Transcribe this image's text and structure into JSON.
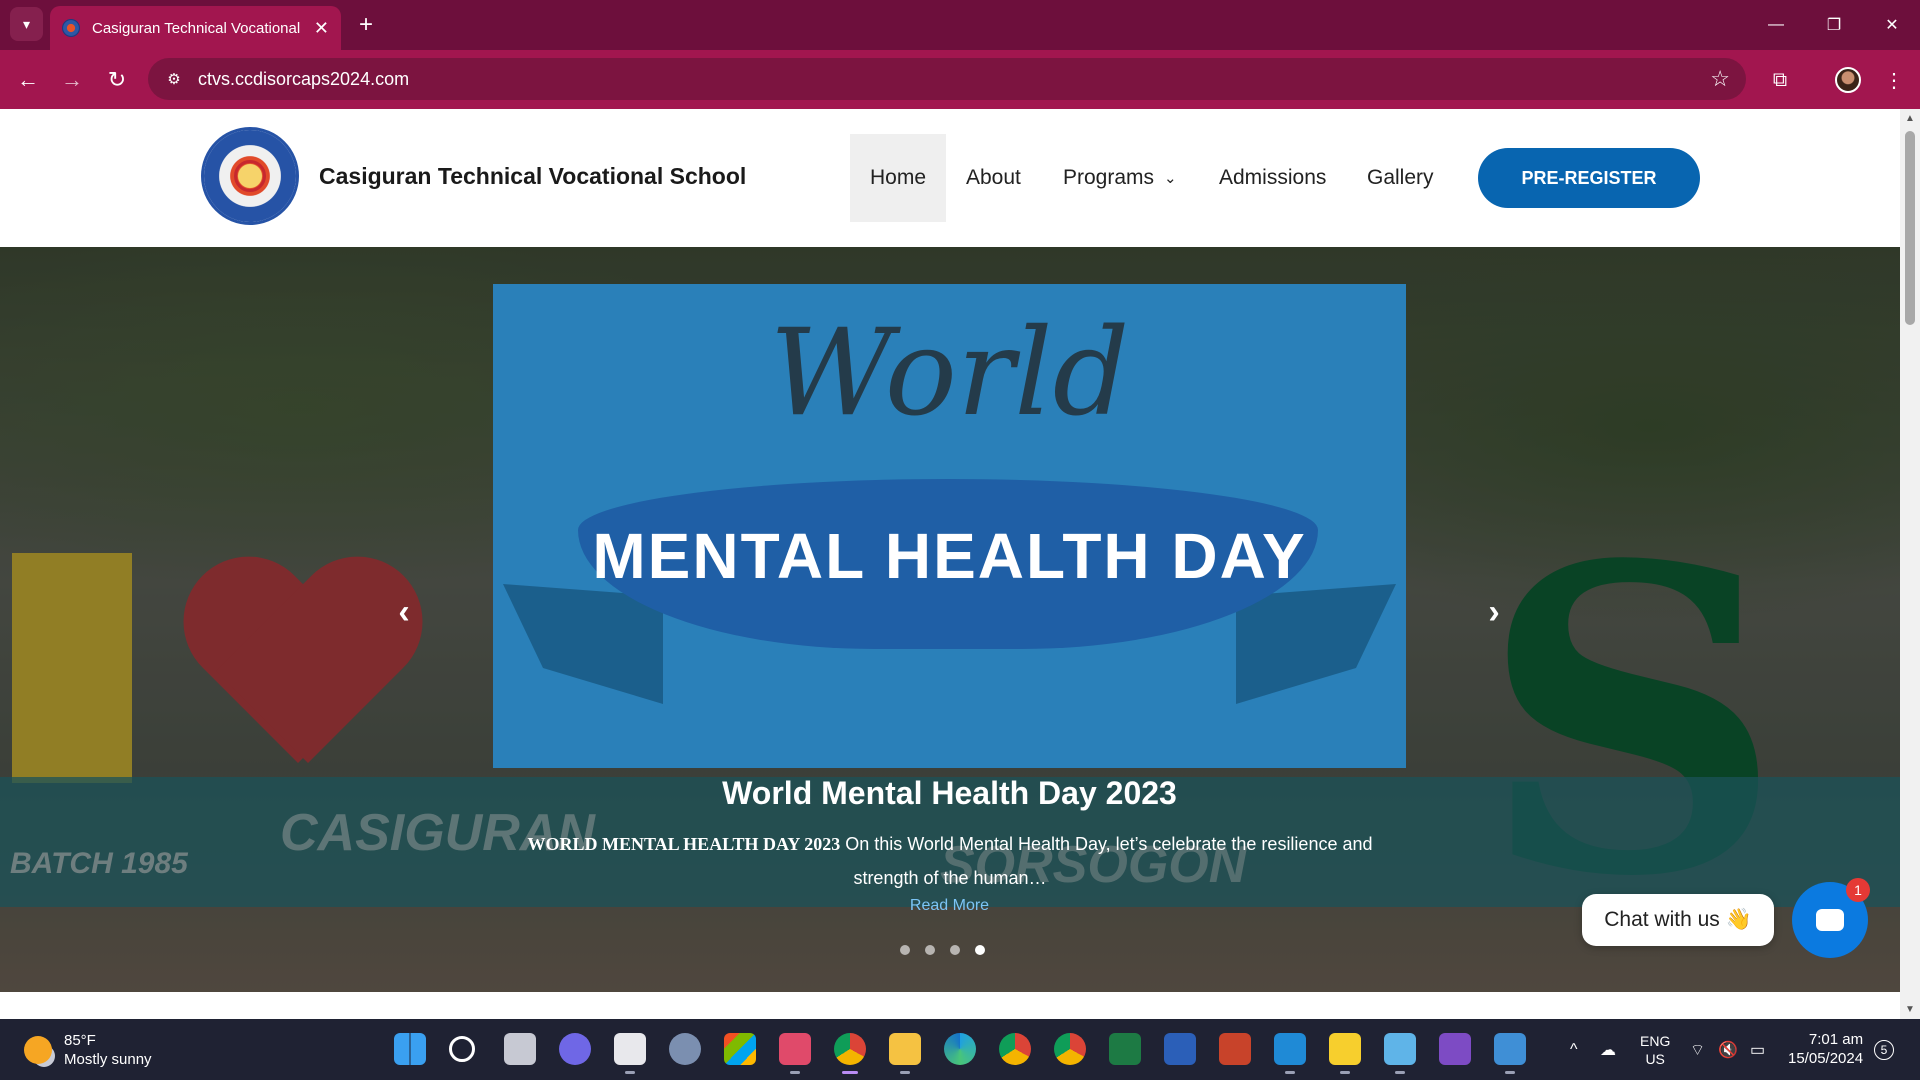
{
  "browser": {
    "tab_title": "Casiguran Technical Vocational",
    "url": "ctvs.ccdisorcaps2024.com",
    "icons": [
      "tab-search-icon",
      "close-icon",
      "new-tab-icon",
      "minimize-icon",
      "restore-icon",
      "window-close-icon",
      "back-icon",
      "forward-icon",
      "reload-icon",
      "site-info-icon",
      "star-icon",
      "extensions-icon",
      "profile-avatar",
      "menu-icon"
    ]
  },
  "site": {
    "name": "Casiguran Technical Vocational School",
    "nav": [
      "Home",
      "About",
      "Programs",
      "Admissions",
      "Gallery"
    ],
    "active_nav": "Home",
    "cta": "PRE-REGISTER"
  },
  "hero": {
    "image_banner": {
      "script_word": "World",
      "ribbon_text": "MENTAL HEALTH DAY"
    },
    "background_text": {
      "casiguran": "CASIGURAN",
      "sorsogon": "SORSOGON",
      "batch": "BATCH 1985"
    },
    "slide_title": "World Mental Health Day 2023",
    "slide_desc_lead": "WORLD MENTAL HEALTH DAY 2023",
    "slide_desc_rest": " On this World Mental Health Day, let’s celebrate the resilience and strength of the human…",
    "read_more": "Read More",
    "dots_total": 4,
    "active_dot": 4
  },
  "chat": {
    "label": "Chat with us 👋",
    "badge": "1"
  },
  "taskbar": {
    "weather_temp": "85°F",
    "weather_desc": "Mostly sunny",
    "lang_top": "ENG",
    "lang_bottom": "US",
    "time": "7:01 am",
    "date": "15/05/2024",
    "notifications": "5"
  },
  "colors": {
    "browser_frame": "#6d0f3c",
    "browser_toolbar": "#a2164f",
    "cta_blue": "#0865b0",
    "slide_blue": "#2a80b9",
    "chat_blue": "#0b7ae0"
  }
}
